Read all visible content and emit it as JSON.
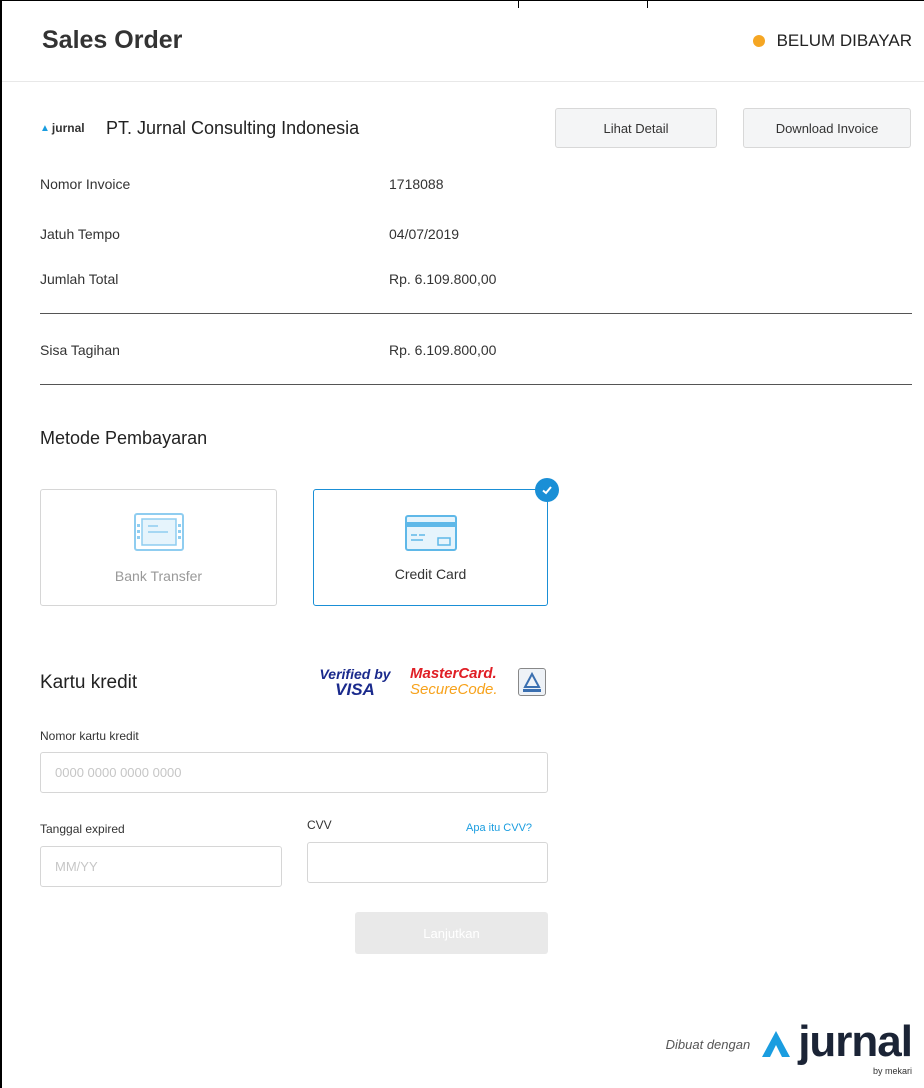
{
  "header": {
    "title": "Sales Order",
    "status": "BELUM DIBAYAR",
    "status_color": "#f5a623"
  },
  "company": {
    "logo_text": "jurnal",
    "name": "PT. Jurnal Consulting Indonesia",
    "detail_button": "Lihat Detail",
    "download_button": "Download Invoice"
  },
  "invoice": {
    "number_label": "Nomor Invoice",
    "number_value": "1718088",
    "due_label": "Jatuh Tempo",
    "due_value": "04/07/2019",
    "total_label": "Jumlah Total",
    "total_value": "Rp. 6.109.800,00",
    "remaining_label": "Sisa Tagihan",
    "remaining_value": "Rp. 6.109.800,00"
  },
  "payment": {
    "section_title": "Metode Pembayaran",
    "methods": [
      {
        "label": "Bank Transfer",
        "icon": "bank-transfer-icon",
        "selected": false
      },
      {
        "label": "Credit Card",
        "icon": "credit-card-icon",
        "selected": true
      }
    ],
    "accent_color": "#1a8fd6"
  },
  "credit_card": {
    "title": "Kartu kredit",
    "badge_visa_line1": "Verified by",
    "badge_visa_line2": "VISA",
    "badge_mc_line1": "MasterCard.",
    "badge_mc_line2": "SecureCode.",
    "card_number_label": "Nomor kartu kredit",
    "card_number_placeholder": "0000 0000 0000 0000",
    "card_number_value": "",
    "expiry_label": "Tanggal expired",
    "expiry_placeholder": "MM/YY",
    "expiry_value": "",
    "cvv_label": "CVV",
    "cvv_value": "",
    "cvv_help": "Apa itu CVV?",
    "submit": "Lanjutkan"
  },
  "footer": {
    "made_with": "Dibuat dengan",
    "brand": "jurnal",
    "brand_sub": "by mekari"
  }
}
